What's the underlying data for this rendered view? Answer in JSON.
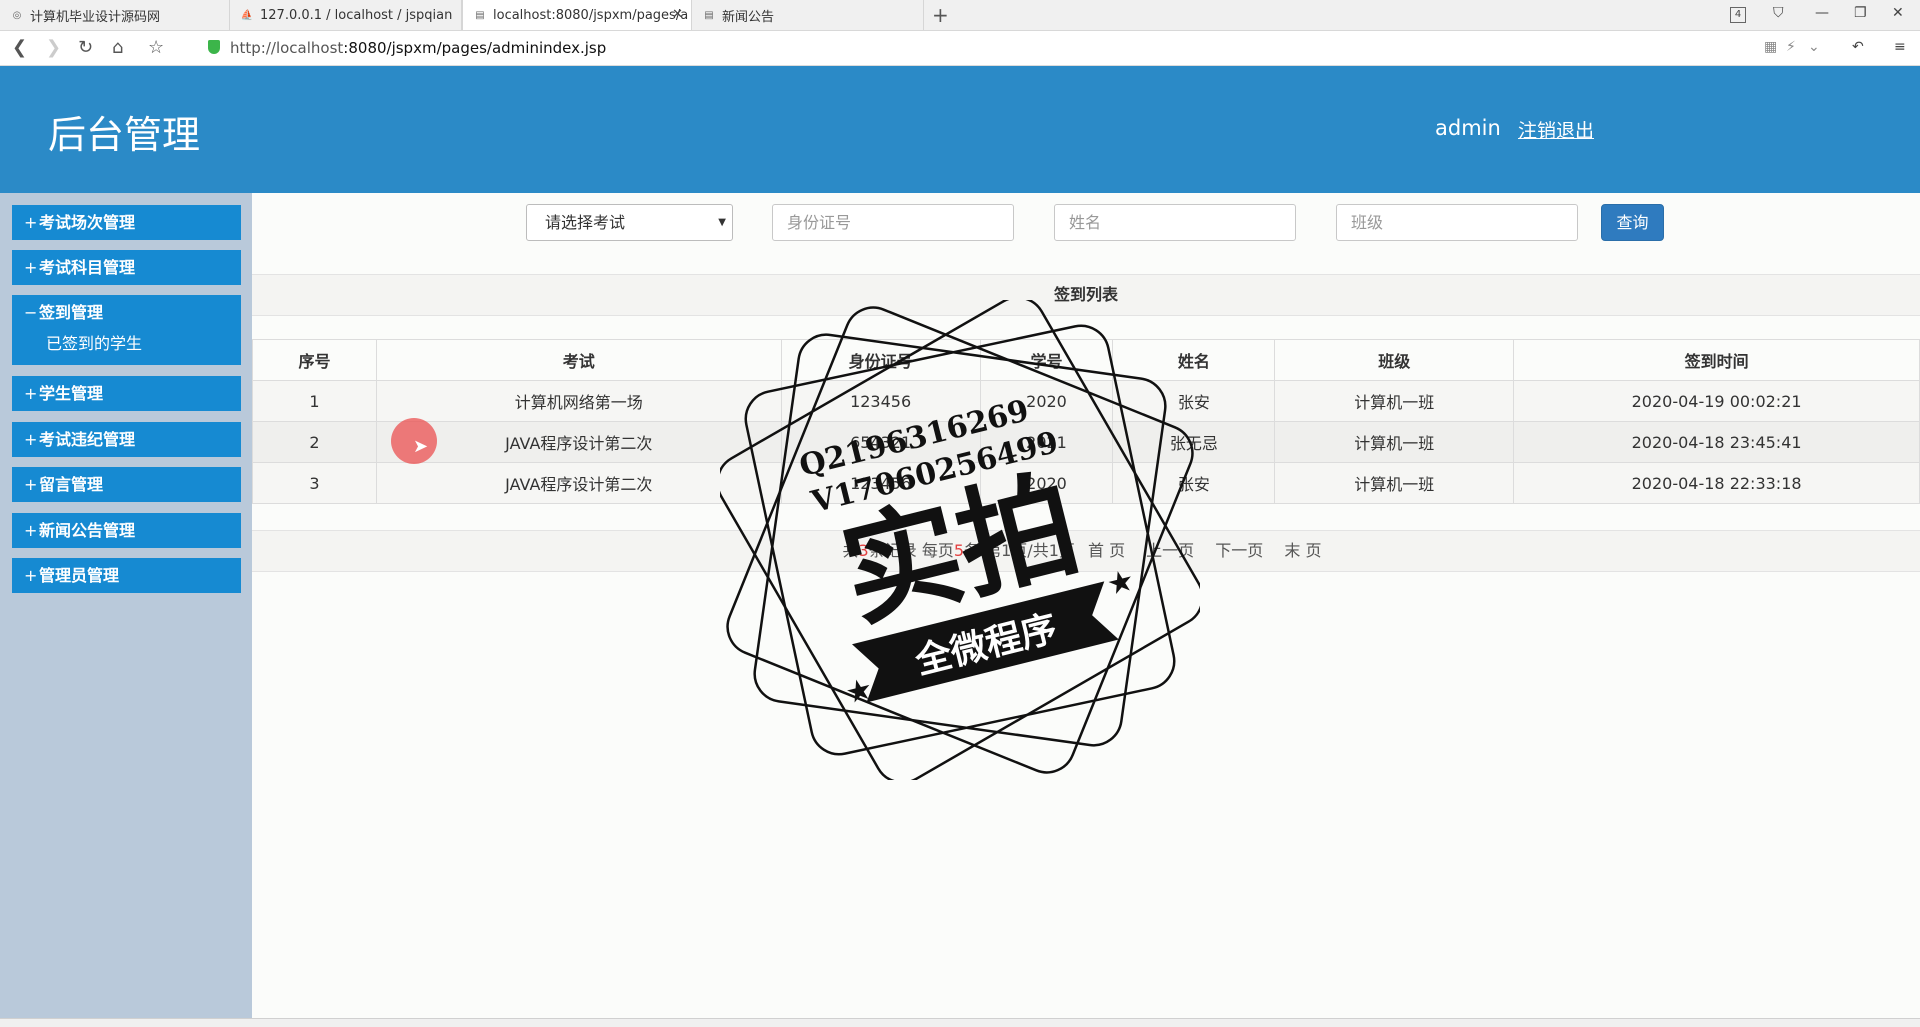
{
  "browser": {
    "tabs": [
      {
        "title": "计算机毕业设计源码网",
        "icon": "globe-icon"
      },
      {
        "title": "127.0.0.1 / localhost / jspqian",
        "icon": "phpmyadmin-icon"
      },
      {
        "title": "localhost:8080/jspxm/pages/a",
        "icon": "page-icon"
      },
      {
        "title": "新闻公告",
        "icon": "page-icon"
      }
    ],
    "tab_count": "4",
    "url_host": "http://localhost",
    "url_rest": ":8080/jspxm/pages/adminindex.jsp"
  },
  "header": {
    "title": "后台管理",
    "user": "admin",
    "logout": "注销退出"
  },
  "sidebar": {
    "items": [
      {
        "label": "考试场次管理",
        "sign": "+"
      },
      {
        "label": "考试科目管理",
        "sign": "+"
      },
      {
        "label": "签到管理",
        "sign": "−",
        "sub": "已签到的学生"
      },
      {
        "label": "学生管理",
        "sign": "+"
      },
      {
        "label": "考试违纪管理",
        "sign": "+"
      },
      {
        "label": "留言管理",
        "sign": "+"
      },
      {
        "label": "新闻公告管理",
        "sign": "+"
      },
      {
        "label": "管理员管理",
        "sign": "+"
      }
    ]
  },
  "search": {
    "exam_select": "请选择考试",
    "id_placeholder": "身份证号",
    "name_placeholder": "姓名",
    "class_placeholder": "班级",
    "query_label": "查询"
  },
  "panel": {
    "title": "签到列表"
  },
  "table": {
    "headers": [
      "序号",
      "考试",
      "身份证号",
      "学号",
      "姓名",
      "班级",
      "签到时间"
    ],
    "rows": [
      [
        "1",
        "计算机网络第一场",
        "123456",
        "2020",
        "张安",
        "计算机一班",
        "2020-04-19 00:02:21"
      ],
      [
        "2",
        "JAVA程序设计第二次",
        "654321",
        "2021",
        "张无忌",
        "计算机一班",
        "2020-04-18 23:45:41"
      ],
      [
        "3",
        "JAVA程序设计第二次",
        "123456",
        "2020",
        "张安",
        "计算机一班",
        "2020-04-18 22:33:18"
      ]
    ]
  },
  "pager": {
    "total_prefix": "共",
    "total": "3",
    "total_suffix": "条记录",
    "per_prefix": "每页",
    "per": "5",
    "per_suffix": "条",
    "page_info": "第1页/共1页",
    "first": "首 页",
    "prev": "上一页",
    "next": "下一页",
    "last": "末 页"
  },
  "watermark": {
    "line1": "Q2196316269",
    "line2": "V17060256499",
    "main": "实拍",
    "banner": "全微程序"
  },
  "colors": {
    "header_bg": "#2b8ac7",
    "menu_bg": "#168ad2",
    "sidebar_bg": "#b9c9da",
    "query_btn": "#2f7bbf"
  }
}
